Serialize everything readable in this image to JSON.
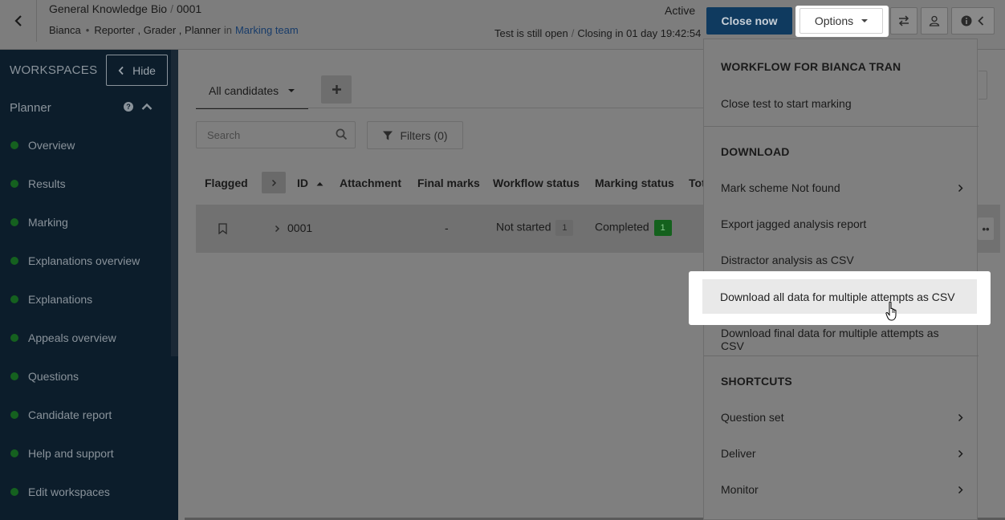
{
  "header": {
    "crumb_parent": "General Knowledge Bio",
    "crumb_sep": "/",
    "crumb_id": "0001",
    "user": "Bianca",
    "roles": "Reporter , Grader , Planner",
    "in_label": "in",
    "team": "Marking team",
    "status": "Active",
    "open_state": "Test is still open",
    "closing": "Closing in 01 day 19:42:54",
    "close_now_label": "Close now",
    "options_label": "Options"
  },
  "sidebar": {
    "title": "WORKSPACES",
    "hide_label": "Hide",
    "section": "Planner",
    "items": [
      {
        "label": "Overview"
      },
      {
        "label": "Results"
      },
      {
        "label": "Marking"
      },
      {
        "label": "Explanations overview"
      },
      {
        "label": "Explanations"
      },
      {
        "label": "Appeals overview"
      },
      {
        "label": "Questions"
      },
      {
        "label": "Candidate report"
      },
      {
        "label": "Help and support"
      },
      {
        "label": "Edit workspaces"
      }
    ]
  },
  "main": {
    "tab_label": "All candidates",
    "search_placeholder": "Search",
    "filters_label": "Filters (0)",
    "columns": {
      "flagged": "Flagged",
      "id": "ID",
      "attachment": "Attachment",
      "final_marks": "Final marks",
      "workflow_status": "Workflow status",
      "marking_status": "Marking status",
      "total": "Tot"
    },
    "row": {
      "id": "0001",
      "final_marks": "-",
      "workflow_status": "Not started",
      "workflow_count": "1",
      "marking_status": "Completed",
      "marking_count": "1"
    }
  },
  "dropdown": {
    "workflow_heading": "WORKFLOW FOR BIANCA TRAN",
    "close_to_mark": "Close test to start marking",
    "download_heading": "DOWNLOAD",
    "mark_scheme": "Mark scheme Not found",
    "jagged": "Export jagged analysis report",
    "distractor": "Distractor analysis as CSV",
    "download_all": "Download all data for multiple attempts as CSV",
    "download_final": "Download final data for multiple attempts as CSV",
    "shortcuts_heading": "SHORTCUTS",
    "question_set": "Question set",
    "deliver": "Deliver",
    "monitor": "Monitor"
  },
  "colors": {
    "sidebar_bg": "#0c1d2b",
    "nav_dot": "#15611f",
    "close_now_bg": "#0f3a5f",
    "highlight_bg": "#ffffff"
  },
  "icons": [
    "chevron-left-icon",
    "caret-down-icon",
    "swap-icon",
    "user-icon",
    "info-icon",
    "help-icon",
    "chevron-up-icon",
    "plus-icon",
    "search-icon",
    "filter-icon",
    "sort-up-icon",
    "bookmark-icon",
    "chevron-right-icon",
    "more-icon",
    "hand-cursor-icon"
  ]
}
